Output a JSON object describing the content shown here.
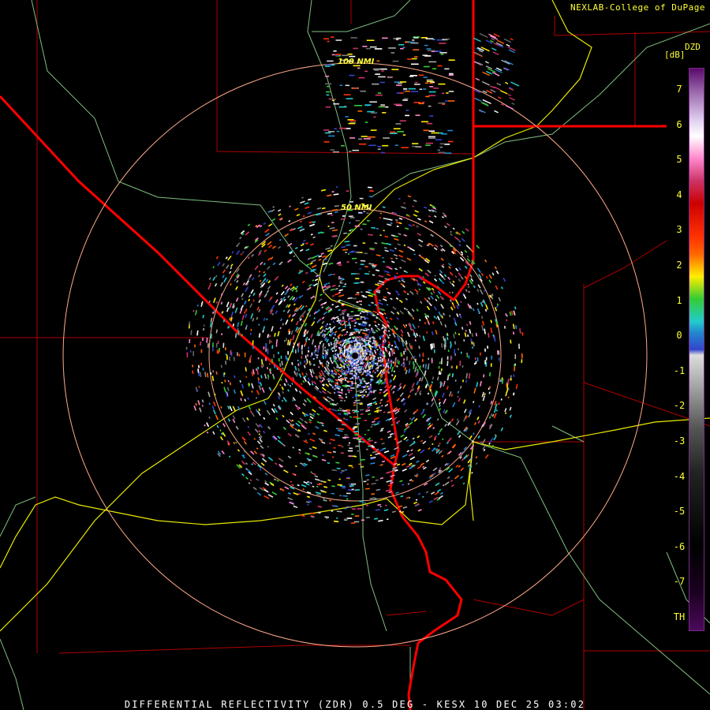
{
  "credit": "NEXLAB-College of DuPage",
  "caption": "DIFFERENTIAL REFLECTIVITY (ZDR) 0.5 DEG - KESX 10 DEC 25 03:02",
  "range_rings": [
    {
      "label": "50 NMI",
      "radius_nmi": 50
    },
    {
      "label": "100 NMI",
      "radius_nmi": 100
    }
  ],
  "legend": {
    "product": "DZD",
    "unit": "[dB]",
    "ticks": [
      "7",
      "6",
      "5",
      "4",
      "3",
      "2",
      "1",
      "0",
      "-1",
      "-2",
      "-3",
      "-4",
      "-5",
      "-6",
      "-7",
      "TH"
    ],
    "colors": {
      "top": "#5a0a6a",
      "pink": "#ff88cc",
      "red": "#cc0000",
      "orange": "#ff6600",
      "yellow": "#ffee00",
      "green": "#33cc33",
      "cyan": "#22cccc",
      "blue": "#3344cc",
      "light_gray": "#dddddd",
      "dark_gray": "#555555",
      "black": "#000000",
      "purple_bottom": "#4a0a5a"
    }
  },
  "map_colors": {
    "state_border": "#ff0000",
    "county_border": "#cc0000",
    "highway": "#e8e800",
    "secondary_road": "#7fbf7f",
    "range_ring": "#ffaa88"
  }
}
